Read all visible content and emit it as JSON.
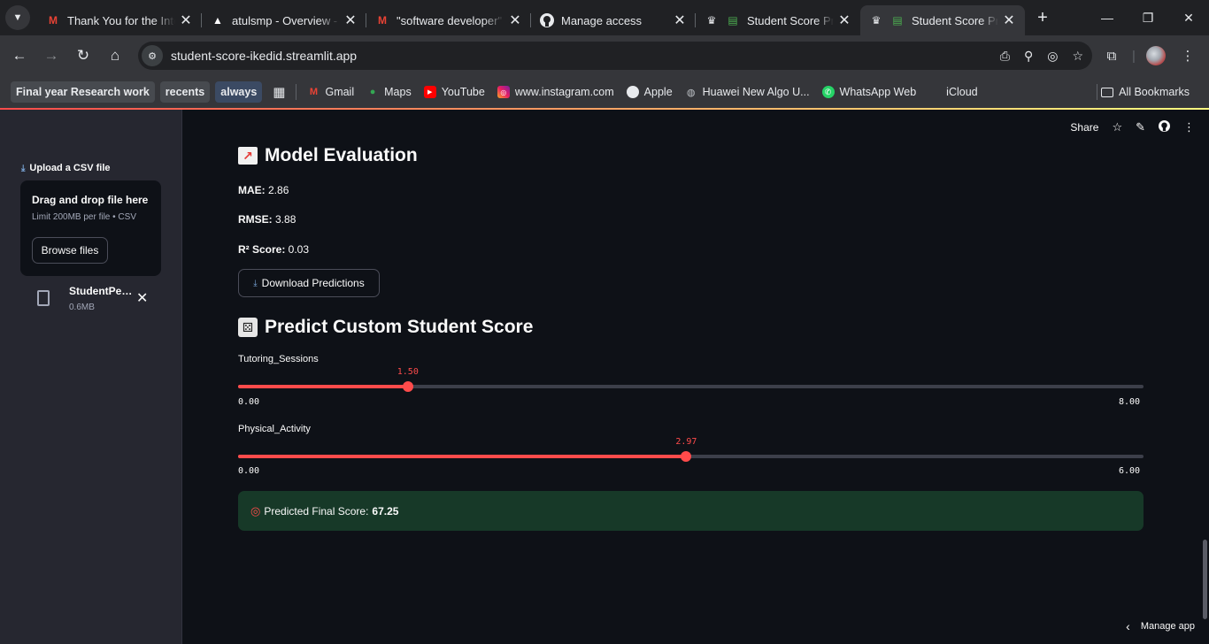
{
  "browser": {
    "tabs": [
      {
        "title": "Thank You for the Interest",
        "favicon": "gmail-icon",
        "active": false
      },
      {
        "title": "atulsmp - Overview - Vercel",
        "favicon": "vercel-icon",
        "active": false
      },
      {
        "title": "\"software developer\" - Gmail",
        "favicon": "gmail-icon",
        "active": false
      },
      {
        "title": "Manage access",
        "favicon": "github-icon",
        "active": false
      },
      {
        "title": "Student Score Predictor",
        "favicon": "streamlit-icon",
        "active": false
      },
      {
        "title": "Student Score Predictor",
        "favicon": "streamlit-icon",
        "active": true
      }
    ],
    "url": "student-score-ikedid.streamlit.app",
    "bookmarks": [
      {
        "label": "Final year Research work",
        "style": "pill"
      },
      {
        "label": "recents",
        "style": "pill"
      },
      {
        "label": "always",
        "style": "pill-blue"
      },
      {
        "label": "Gmail",
        "icon": "gmail-icon"
      },
      {
        "label": "Maps",
        "icon": "maps-icon"
      },
      {
        "label": "YouTube",
        "icon": "youtube-icon"
      },
      {
        "label": "www.instagram.com",
        "icon": "instagram-icon"
      },
      {
        "label": "Apple",
        "icon": "apple-icon"
      },
      {
        "label": "Huawei New Algo U...",
        "icon": "globe-icon"
      },
      {
        "label": "WhatsApp Web",
        "icon": "whatsapp-icon"
      },
      {
        "label": "iCloud",
        "icon": "apple-icon"
      }
    ],
    "all_bookmarks": "All Bookmarks"
  },
  "sidebar": {
    "upload_label": "Upload a CSV file",
    "dropzone_title": "Drag and drop file here",
    "dropzone_sub": "Limit 200MB per file • CSV",
    "browse_button": "Browse files",
    "file_name": "StudentPerformanceFactors.csv",
    "file_size": "0.6MB"
  },
  "header": {
    "share": "Share"
  },
  "evaluation": {
    "title": "Model Evaluation",
    "mae_label": "MAE:",
    "mae_value": " 2.86",
    "rmse_label": "RMSE:",
    "rmse_value": " 3.88",
    "r2_label": "R² Score:",
    "r2_value": " 0.03",
    "download_button": "Download Predictions"
  },
  "predict": {
    "title": "Predict Custom Student Score",
    "sliders": [
      {
        "label": "Tutoring_Sessions",
        "value": 1.5,
        "value_text": "1.50",
        "min": 0,
        "max": 8,
        "min_text": "0.00",
        "max_text": "8.00"
      },
      {
        "label": "Physical_Activity",
        "value": 2.97,
        "value_text": "2.97",
        "min": 0,
        "max": 6,
        "min_text": "0.00",
        "max_text": "6.00"
      }
    ],
    "result_label": "Predicted Final Score:",
    "result_value": "67.25"
  },
  "footer": {
    "manage_app": "Manage app"
  },
  "colors": {
    "accent": "#ff4b4b",
    "success_bg": "#173928",
    "app_bg": "#0e1117",
    "sidebar_bg": "#262730"
  }
}
